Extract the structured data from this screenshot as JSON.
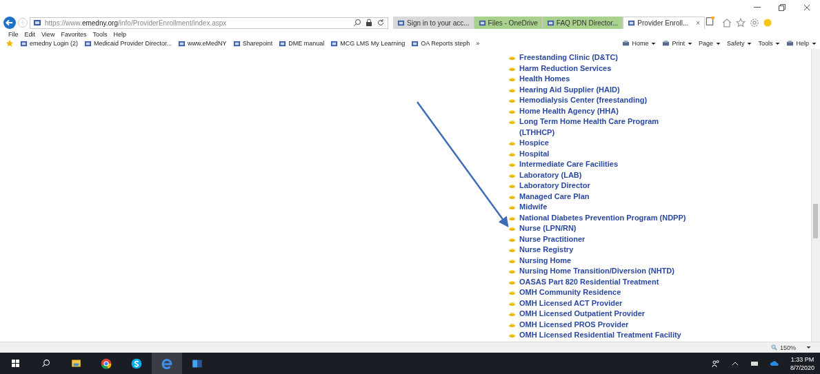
{
  "address_bar": {
    "url": "https://www.**emedny.org**/info/ProviderEnrollment/index.aspx"
  },
  "tabs": [
    {
      "label": "Sign in to your acc...",
      "selected": false,
      "color": "#d9d9d9"
    },
    {
      "label": "Files - OneDrive",
      "selected": false,
      "color": "#a9d18e"
    },
    {
      "label": "FAQ PDN Director...",
      "selected": false,
      "color": "#a9d18e"
    },
    {
      "label": "Provider Enroll...",
      "selected": true,
      "color": "#ffffff"
    }
  ],
  "active_tab_close": "×",
  "menu": [
    "File",
    "Edit",
    "View",
    "Favorites",
    "Tools",
    "Help"
  ],
  "favorites": [
    "emedny Login (2)",
    "Medicaid Provider Director...",
    "www.eMedNY",
    "Sharepoint",
    "DME manual",
    "MCG LMS My Learning",
    "OA Reports steph"
  ],
  "overflow": "»",
  "commands": [
    {
      "label": "Home",
      "icon": true
    },
    {
      "label": "Print",
      "icon": true
    },
    {
      "label": "Page",
      "icon": false
    },
    {
      "label": "Safety",
      "icon": false
    },
    {
      "label": "Tools",
      "icon": false
    },
    {
      "label": "Help",
      "icon": true
    }
  ],
  "provider_types": [
    "Freestanding Clinic (D&TC)",
    "Harm Reduction Services",
    "Health Homes",
    "Hearing Aid Supplier (HAID)",
    "Hemodialysis Center (freestanding)",
    "Home Health Agency (HHA)",
    "Long Term Home Health Care Program (LTHHCP)",
    "Hospice",
    "Hospital",
    "Intermediate Care Facilities",
    "Laboratory (LAB)",
    "Laboratory Director",
    "Managed Care Plan",
    "Midwife",
    "National Diabetes Prevention Program (NDPP)",
    "Nurse (LPN/RN)",
    "Nurse Practitioner",
    "Nurse Registry",
    "Nursing Home",
    "Nursing Home Transition/Diversion (NHTD)",
    "OASAS Part 820 Residential Treatment",
    "OMH Community Residence",
    "OMH Licensed ACT Provider",
    "OMH Licensed Outpatient Provider",
    "OMH Licensed PROS Provider",
    "OMH Licensed Residential Treatment Facility"
  ],
  "zoom": "150%",
  "clock": {
    "time": "1:33 PM",
    "date": "8/7/2020"
  }
}
